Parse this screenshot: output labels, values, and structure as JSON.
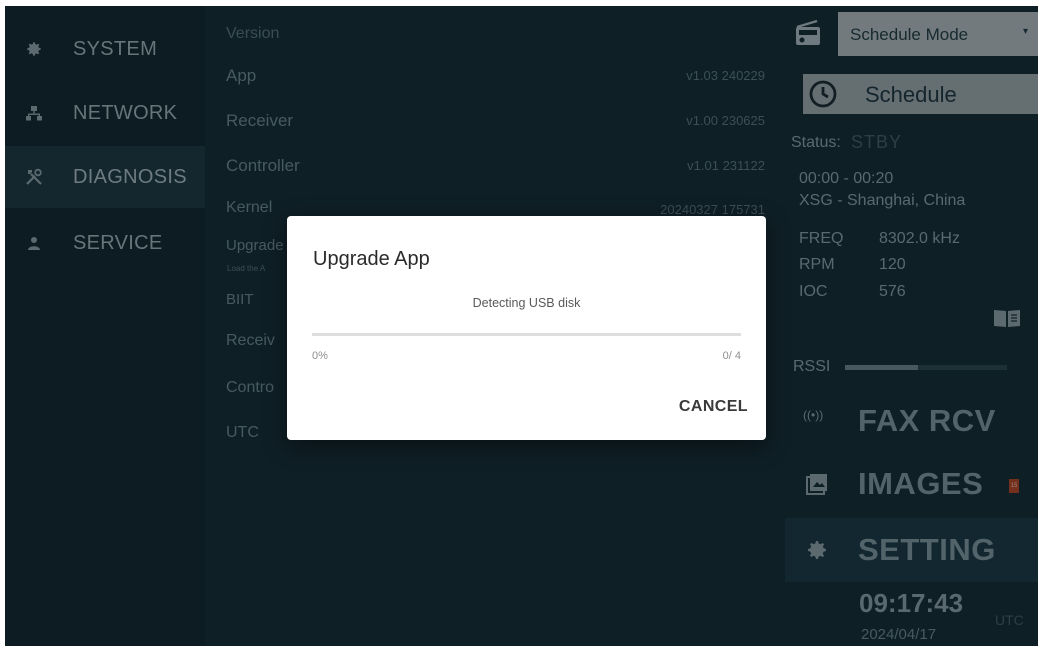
{
  "nav": {
    "items": [
      {
        "label": "SYSTEM",
        "icon": "gear-icon"
      },
      {
        "label": "NETWORK",
        "icon": "network-icon"
      },
      {
        "label": "DIAGNOSIS",
        "icon": "tools-icon",
        "active": true
      },
      {
        "label": "SERVICE",
        "icon": "person-icon"
      }
    ]
  },
  "version": {
    "header": "Version",
    "rows": [
      {
        "label": "App",
        "value": "v1.03 240229"
      },
      {
        "label": "Receiver",
        "value": "v1.00 230625"
      },
      {
        "label": "Controller",
        "value": "v1.01 231122"
      },
      {
        "label": "Kernel",
        "value": "20240327 175731"
      }
    ],
    "upgrade_label": "Upgrade",
    "upgrade_sub": "Load the A",
    "biit_label": "BIIT",
    "receiver_label": "Receiv",
    "controller_label": "Contro",
    "utc_label": "UTC"
  },
  "right": {
    "mode": "Schedule Mode",
    "schedule_button": "Schedule",
    "status_label": "Status:",
    "status_value": "STBY",
    "time_range": "00:00 - 00:20",
    "station": "XSG - Shanghai, China",
    "params": [
      {
        "label": "FREQ",
        "value": "8302.0 kHz"
      },
      {
        "label": "RPM",
        "value": "120"
      },
      {
        "label": "IOC",
        "value": "576"
      }
    ],
    "rssi_label": "RSSI",
    "rssi_level": 0.45,
    "fax_label": "FAX RCV",
    "images_label": "IMAGES",
    "images_badge": "15",
    "setting_label": "SETTING",
    "clock_time": "09:17:43",
    "clock_zone": "UTC",
    "clock_date": "2024/04/17"
  },
  "dialog": {
    "title": "Upgrade App",
    "message": "Detecting USB disk",
    "progress_percent": "0%",
    "progress_count": "0/ 4",
    "progress_fraction": 0,
    "cancel_label": "CANCEL"
  },
  "colors": {
    "background": "#17303b",
    "nav_active": "#1f3d49",
    "dialog": "#ffffff",
    "mode_select": "#b0bcc1",
    "badge": "#b4492d"
  }
}
